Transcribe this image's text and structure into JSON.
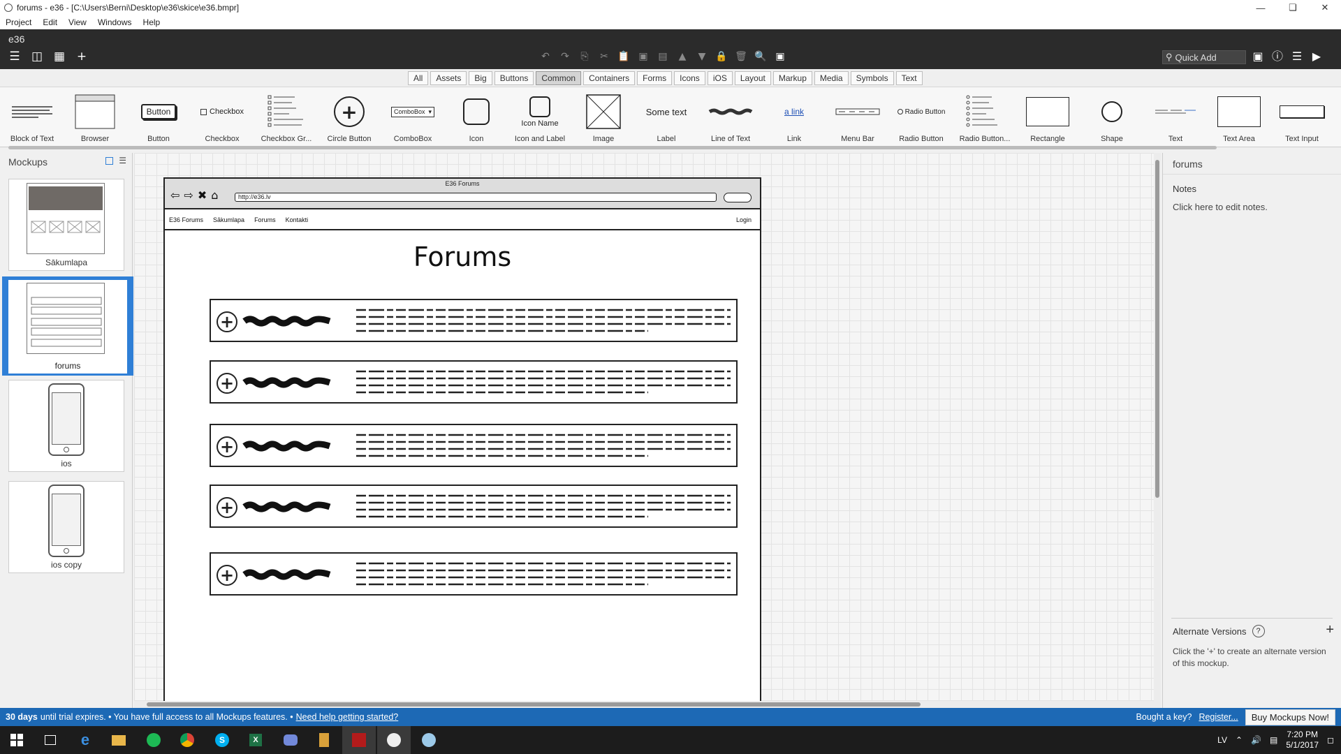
{
  "window": {
    "title": "forums - e36 - [C:\\Users\\Berni\\Desktop\\e36\\skice\\e36.bmpr]"
  },
  "menu": [
    "Project",
    "Edit",
    "View",
    "Windows",
    "Help"
  ],
  "project_name": "e36",
  "quick_add_placeholder": "Quick Add",
  "categories": {
    "items": [
      "All",
      "Assets",
      "Big",
      "Buttons",
      "Common",
      "Containers",
      "Forms",
      "Icons",
      "iOS",
      "Layout",
      "Markup",
      "Media",
      "Symbols",
      "Text"
    ],
    "active": "Common"
  },
  "library": {
    "items": [
      "Block of Text",
      "Browser",
      "Button",
      "Checkbox",
      "Checkbox Gr...",
      "Circle Button",
      "ComboBox",
      "Icon",
      "Icon and Label",
      "Image",
      "Label",
      "Line of Text",
      "Link",
      "Menu Bar",
      "Radio Button",
      "Radio Button...",
      "Rectangle",
      "Shape",
      "Text",
      "Text Area",
      "Text Input"
    ],
    "preview_texts": {
      "button": "Button",
      "checkbox": "Checkbox",
      "combobox": "ComboBox",
      "icon_name": "Icon Name",
      "label": "Some text",
      "link": "a link",
      "radio": "Radio Button"
    }
  },
  "mockups_panel": {
    "title": "Mockups",
    "items": [
      "Sākumlapa",
      "forums",
      "ios",
      "ios copy"
    ],
    "selected": "forums"
  },
  "mockup": {
    "browser_title": "E36 Forums",
    "url": "http://e36.lv",
    "menu_items": [
      "E36 Forums",
      "Sākumlapa",
      "Forums",
      "Kontakti"
    ],
    "login": "Login",
    "heading": "Forums",
    "row_count": 5
  },
  "right_panel": {
    "title": "forums",
    "notes_label": "Notes",
    "notes_placeholder": "Click here to edit notes.",
    "alternate_title": "Alternate Versions",
    "alternate_desc": "Click the '+' to create an alternate version of this mockup."
  },
  "statusbar": {
    "days": "30 days",
    "trial_text": "until trial expires. • You have full access to all Mockups features. •",
    "help_link": "Need help getting started?",
    "bought_text": "Bought a key?",
    "register_link": "Register...",
    "buy_button": "Buy Mockups Now!"
  },
  "taskbar": {
    "lang": "LV",
    "time": "7:20 PM",
    "date": "5/1/2017"
  }
}
